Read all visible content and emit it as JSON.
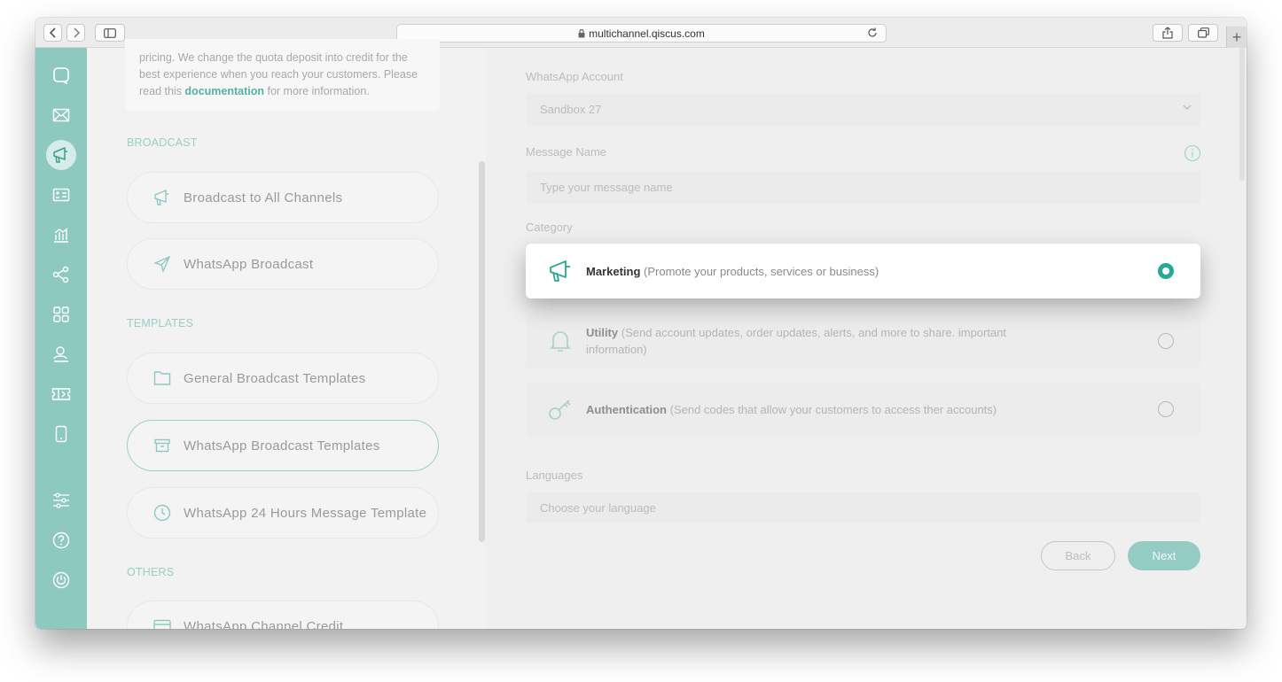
{
  "browser": {
    "url": "multichannel.qiscus.com",
    "plus_label": "+"
  },
  "sidebar_icons": [
    "chat-icon",
    "mail-icon",
    "megaphone-icon",
    "contact-card-icon",
    "analytics-icon",
    "integration-icon",
    "apps-icon",
    "agent-icon",
    "ticket-icon",
    "mobile-icon",
    "settings-sliders-icon",
    "help-icon",
    "power-icon"
  ],
  "left": {
    "info_text_before": "pricing. We change the quota deposit into credit for the best experience when you reach your customers. Please read this ",
    "info_link": "documentation",
    "info_text_after": " for more information.",
    "section_broadcast": "BROADCAST",
    "broadcast_all": "Broadcast to All Channels",
    "whatsapp_broadcast": "WhatsApp Broadcast",
    "section_templates": "TEMPLATES",
    "general_templates": "General Broadcast Templates",
    "wa_templates": "WhatsApp Broadcast Templates",
    "wa_24h": "WhatsApp 24 Hours Message Template",
    "section_others": "OTHERS",
    "wa_credit": "WhatsApp Channel Credit"
  },
  "form": {
    "wa_account_label": "WhatsApp Account",
    "wa_account_value": "Sandbox 27",
    "message_name_label": "Message Name",
    "message_name_placeholder": "Type your message name",
    "category_label": "Category",
    "categories": [
      {
        "title": "Marketing",
        "desc": " (Promote your products, services or business)",
        "selected": true
      },
      {
        "title": "Utility",
        "desc": " (Send account updates, order updates, alerts, and more to share. important information)",
        "selected": false
      },
      {
        "title": "Authentication",
        "desc": " (Send codes that allow your customers to access ther accounts)",
        "selected": false
      }
    ],
    "languages_label": "Languages",
    "languages_placeholder": "Choose your language",
    "back_label": "Back",
    "next_label": "Next"
  },
  "colors": {
    "accent": "#29a894",
    "sidebar": "#8ec9c0"
  }
}
